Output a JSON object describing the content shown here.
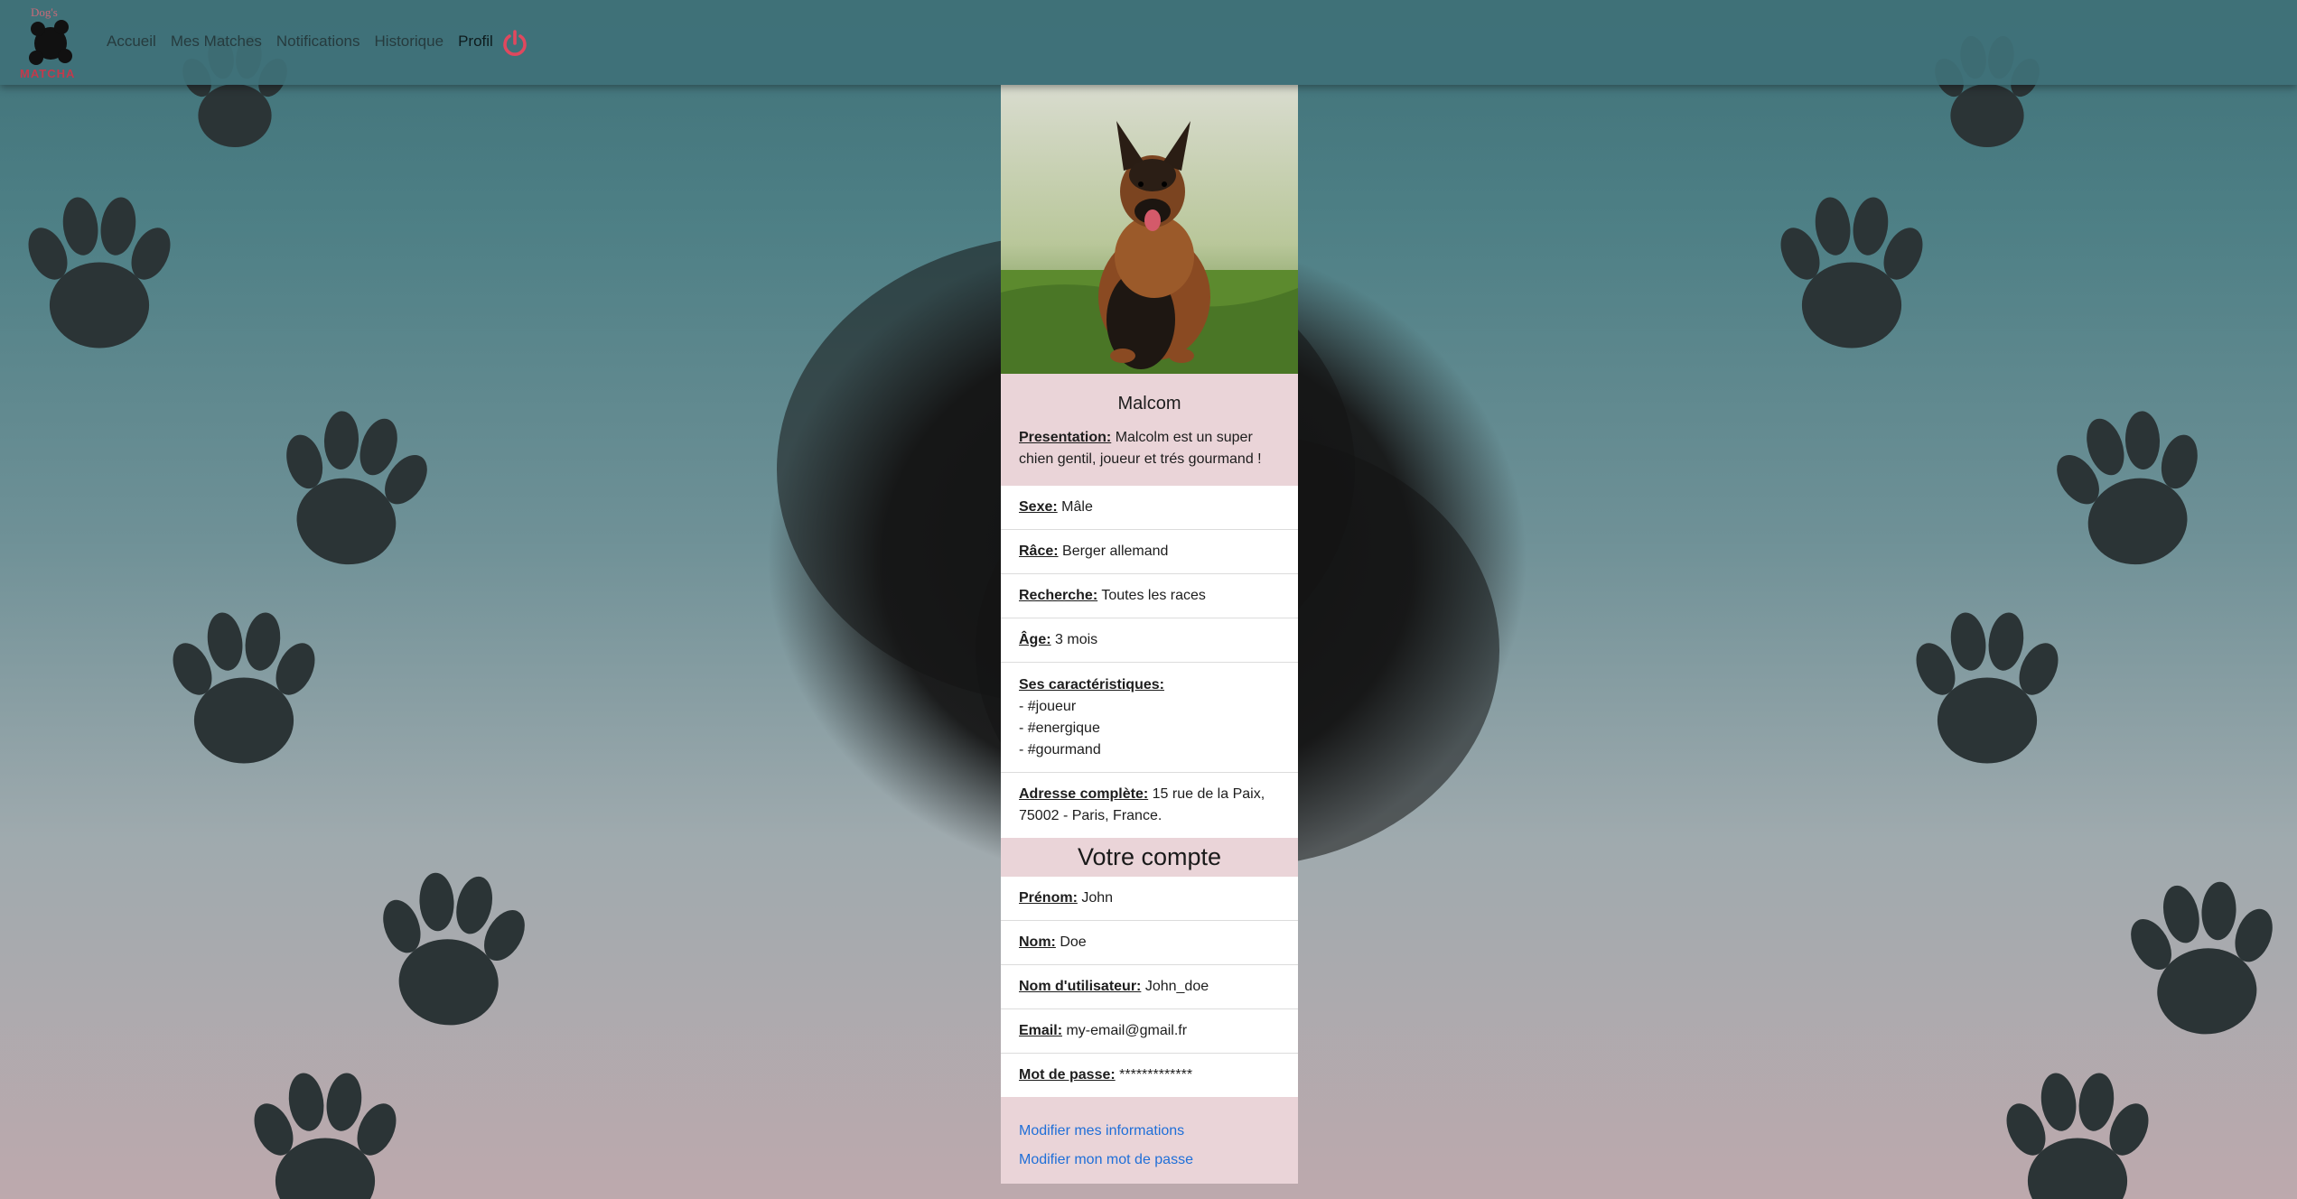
{
  "nav": {
    "brand_top": "Dog's",
    "brand_word": "MATCHA",
    "links": [
      {
        "label": "Accueil"
      },
      {
        "label": "Mes Matches"
      },
      {
        "label": "Notifications"
      },
      {
        "label": "Historique"
      },
      {
        "label": "Profil"
      }
    ],
    "power_icon": "power-icon"
  },
  "profile": {
    "name": "Malcom",
    "presentation_label": "Presentation:",
    "presentation": "Malcolm est un super chien gentil, joueur et trés gourmand !",
    "sexe_label": "Sexe:",
    "sexe": "Mâle",
    "race_label": "Râce:",
    "race": "Berger allemand",
    "recherche_label": "Recherche:",
    "recherche": "Toutes les races",
    "age_label": "Âge:",
    "age": "3 mois",
    "traits_label": "Ses caractéristiques:",
    "traits": [
      "- #joueur",
      "- #energique",
      "- #gourmand"
    ],
    "adresse_label": "Adresse complète:",
    "adresse": "15 rue de la Paix, 75002 - Paris, France."
  },
  "account": {
    "title": "Votre compte",
    "prenom_label": "Prénom:",
    "prenom": "John",
    "nom_label": "Nom:",
    "nom": "Doe",
    "username_label": "Nom d'utilisateur:",
    "username": "John_doe",
    "email_label": "Email:",
    "email": "my-email@gmail.fr",
    "password_label": "Mot de passe:",
    "password": "*************",
    "edit_info": "Modifier mes informations",
    "edit_password": "Modifier mon mot de passe"
  },
  "colors": {
    "accent_power": "#e0485e",
    "link_blue": "#1f6fd8",
    "card_pink": "#ead4d8"
  }
}
